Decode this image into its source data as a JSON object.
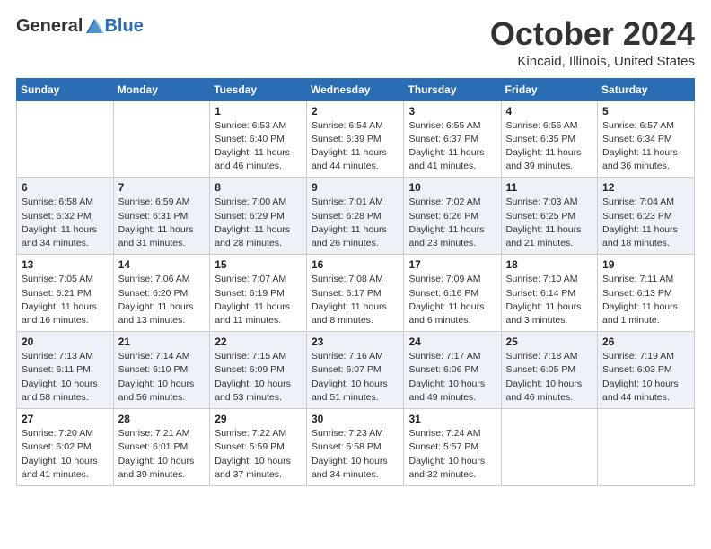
{
  "header": {
    "logo_general": "General",
    "logo_blue": "Blue",
    "month_title": "October 2024",
    "location": "Kincaid, Illinois, United States"
  },
  "days_of_week": [
    "Sunday",
    "Monday",
    "Tuesday",
    "Wednesday",
    "Thursday",
    "Friday",
    "Saturday"
  ],
  "weeks": [
    [
      {
        "day": "",
        "sunrise": "",
        "sunset": "",
        "daylight": ""
      },
      {
        "day": "",
        "sunrise": "",
        "sunset": "",
        "daylight": ""
      },
      {
        "day": "1",
        "sunrise": "Sunrise: 6:53 AM",
        "sunset": "Sunset: 6:40 PM",
        "daylight": "Daylight: 11 hours and 46 minutes."
      },
      {
        "day": "2",
        "sunrise": "Sunrise: 6:54 AM",
        "sunset": "Sunset: 6:39 PM",
        "daylight": "Daylight: 11 hours and 44 minutes."
      },
      {
        "day": "3",
        "sunrise": "Sunrise: 6:55 AM",
        "sunset": "Sunset: 6:37 PM",
        "daylight": "Daylight: 11 hours and 41 minutes."
      },
      {
        "day": "4",
        "sunrise": "Sunrise: 6:56 AM",
        "sunset": "Sunset: 6:35 PM",
        "daylight": "Daylight: 11 hours and 39 minutes."
      },
      {
        "day": "5",
        "sunrise": "Sunrise: 6:57 AM",
        "sunset": "Sunset: 6:34 PM",
        "daylight": "Daylight: 11 hours and 36 minutes."
      }
    ],
    [
      {
        "day": "6",
        "sunrise": "Sunrise: 6:58 AM",
        "sunset": "Sunset: 6:32 PM",
        "daylight": "Daylight: 11 hours and 34 minutes."
      },
      {
        "day": "7",
        "sunrise": "Sunrise: 6:59 AM",
        "sunset": "Sunset: 6:31 PM",
        "daylight": "Daylight: 11 hours and 31 minutes."
      },
      {
        "day": "8",
        "sunrise": "Sunrise: 7:00 AM",
        "sunset": "Sunset: 6:29 PM",
        "daylight": "Daylight: 11 hours and 28 minutes."
      },
      {
        "day": "9",
        "sunrise": "Sunrise: 7:01 AM",
        "sunset": "Sunset: 6:28 PM",
        "daylight": "Daylight: 11 hours and 26 minutes."
      },
      {
        "day": "10",
        "sunrise": "Sunrise: 7:02 AM",
        "sunset": "Sunset: 6:26 PM",
        "daylight": "Daylight: 11 hours and 23 minutes."
      },
      {
        "day": "11",
        "sunrise": "Sunrise: 7:03 AM",
        "sunset": "Sunset: 6:25 PM",
        "daylight": "Daylight: 11 hours and 21 minutes."
      },
      {
        "day": "12",
        "sunrise": "Sunrise: 7:04 AM",
        "sunset": "Sunset: 6:23 PM",
        "daylight": "Daylight: 11 hours and 18 minutes."
      }
    ],
    [
      {
        "day": "13",
        "sunrise": "Sunrise: 7:05 AM",
        "sunset": "Sunset: 6:21 PM",
        "daylight": "Daylight: 11 hours and 16 minutes."
      },
      {
        "day": "14",
        "sunrise": "Sunrise: 7:06 AM",
        "sunset": "Sunset: 6:20 PM",
        "daylight": "Daylight: 11 hours and 13 minutes."
      },
      {
        "day": "15",
        "sunrise": "Sunrise: 7:07 AM",
        "sunset": "Sunset: 6:19 PM",
        "daylight": "Daylight: 11 hours and 11 minutes."
      },
      {
        "day": "16",
        "sunrise": "Sunrise: 7:08 AM",
        "sunset": "Sunset: 6:17 PM",
        "daylight": "Daylight: 11 hours and 8 minutes."
      },
      {
        "day": "17",
        "sunrise": "Sunrise: 7:09 AM",
        "sunset": "Sunset: 6:16 PM",
        "daylight": "Daylight: 11 hours and 6 minutes."
      },
      {
        "day": "18",
        "sunrise": "Sunrise: 7:10 AM",
        "sunset": "Sunset: 6:14 PM",
        "daylight": "Daylight: 11 hours and 3 minutes."
      },
      {
        "day": "19",
        "sunrise": "Sunrise: 7:11 AM",
        "sunset": "Sunset: 6:13 PM",
        "daylight": "Daylight: 11 hours and 1 minute."
      }
    ],
    [
      {
        "day": "20",
        "sunrise": "Sunrise: 7:13 AM",
        "sunset": "Sunset: 6:11 PM",
        "daylight": "Daylight: 10 hours and 58 minutes."
      },
      {
        "day": "21",
        "sunrise": "Sunrise: 7:14 AM",
        "sunset": "Sunset: 6:10 PM",
        "daylight": "Daylight: 10 hours and 56 minutes."
      },
      {
        "day": "22",
        "sunrise": "Sunrise: 7:15 AM",
        "sunset": "Sunset: 6:09 PM",
        "daylight": "Daylight: 10 hours and 53 minutes."
      },
      {
        "day": "23",
        "sunrise": "Sunrise: 7:16 AM",
        "sunset": "Sunset: 6:07 PM",
        "daylight": "Daylight: 10 hours and 51 minutes."
      },
      {
        "day": "24",
        "sunrise": "Sunrise: 7:17 AM",
        "sunset": "Sunset: 6:06 PM",
        "daylight": "Daylight: 10 hours and 49 minutes."
      },
      {
        "day": "25",
        "sunrise": "Sunrise: 7:18 AM",
        "sunset": "Sunset: 6:05 PM",
        "daylight": "Daylight: 10 hours and 46 minutes."
      },
      {
        "day": "26",
        "sunrise": "Sunrise: 7:19 AM",
        "sunset": "Sunset: 6:03 PM",
        "daylight": "Daylight: 10 hours and 44 minutes."
      }
    ],
    [
      {
        "day": "27",
        "sunrise": "Sunrise: 7:20 AM",
        "sunset": "Sunset: 6:02 PM",
        "daylight": "Daylight: 10 hours and 41 minutes."
      },
      {
        "day": "28",
        "sunrise": "Sunrise: 7:21 AM",
        "sunset": "Sunset: 6:01 PM",
        "daylight": "Daylight: 10 hours and 39 minutes."
      },
      {
        "day": "29",
        "sunrise": "Sunrise: 7:22 AM",
        "sunset": "Sunset: 5:59 PM",
        "daylight": "Daylight: 10 hours and 37 minutes."
      },
      {
        "day": "30",
        "sunrise": "Sunrise: 7:23 AM",
        "sunset": "Sunset: 5:58 PM",
        "daylight": "Daylight: 10 hours and 34 minutes."
      },
      {
        "day": "31",
        "sunrise": "Sunrise: 7:24 AM",
        "sunset": "Sunset: 5:57 PM",
        "daylight": "Daylight: 10 hours and 32 minutes."
      },
      {
        "day": "",
        "sunrise": "",
        "sunset": "",
        "daylight": ""
      },
      {
        "day": "",
        "sunrise": "",
        "sunset": "",
        "daylight": ""
      }
    ]
  ]
}
